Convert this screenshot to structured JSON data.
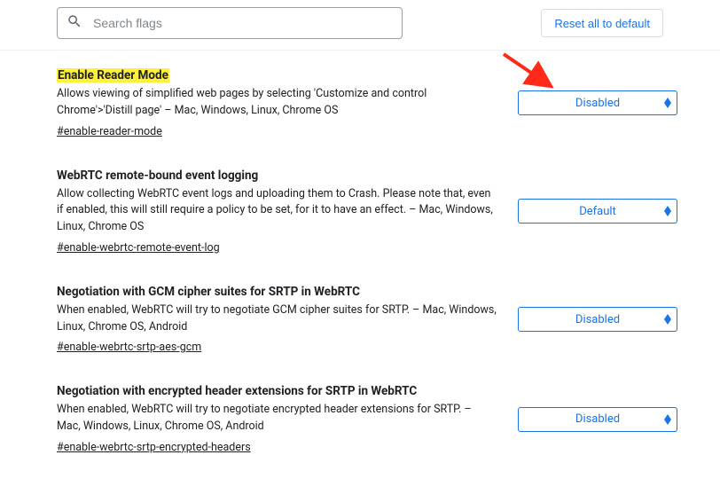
{
  "search": {
    "placeholder": "Search flags"
  },
  "reset_label": "Reset all to default",
  "flags": [
    {
      "title": "Enable Reader Mode",
      "highlight": true,
      "desc": "Allows viewing of simplified web pages by selecting 'Customize and control Chrome'>'Distill page' – Mac, Windows, Linux, Chrome OS",
      "hash": "#enable-reader-mode",
      "value": "Disabled"
    },
    {
      "title": "WebRTC remote-bound event logging",
      "highlight": false,
      "desc": "Allow collecting WebRTC event logs and uploading them to Crash. Please note that, even if enabled, this will still require a policy to be set, for it to have an effect. – Mac, Windows, Linux, Chrome OS",
      "hash": "#enable-webrtc-remote-event-log",
      "value": "Default"
    },
    {
      "title": "Negotiation with GCM cipher suites for SRTP in WebRTC",
      "highlight": false,
      "desc": "When enabled, WebRTC will try to negotiate GCM cipher suites for SRTP. – Mac, Windows, Linux, Chrome OS, Android",
      "hash": "#enable-webrtc-srtp-aes-gcm",
      "value": "Disabled"
    },
    {
      "title": "Negotiation with encrypted header extensions for SRTP in WebRTC",
      "highlight": false,
      "desc": "When enabled, WebRTC will try to negotiate encrypted header extensions for SRTP. – Mac, Windows, Linux, Chrome OS, Android",
      "hash": "#enable-webrtc-srtp-encrypted-headers",
      "value": "Disabled"
    }
  ]
}
